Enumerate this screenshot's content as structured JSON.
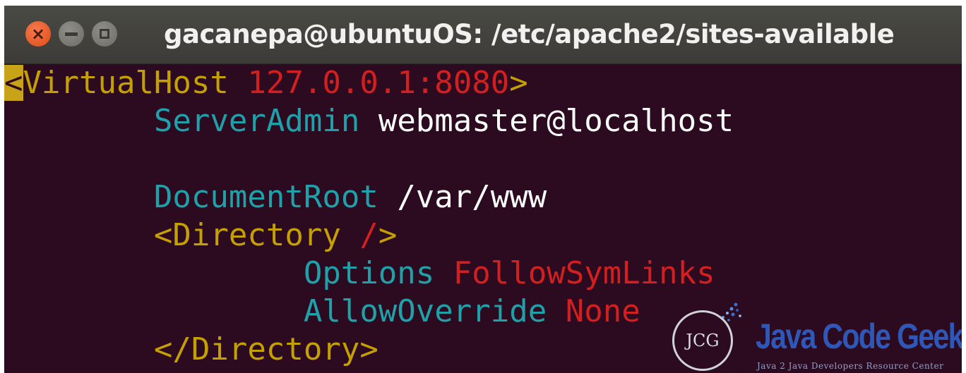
{
  "window": {
    "title": "gacanepa@ubuntuOS: /etc/apache2/sites-available",
    "buttons": {
      "close_glyph": "×",
      "close_icon": "close-icon",
      "minimize_icon": "minimize-icon",
      "maximize_icon": "maximize-icon"
    }
  },
  "colors": {
    "terminal_bg": "#2c0a1f",
    "titlebar_bg": "#3c3b37",
    "close_button": "#df4a16",
    "keyword_yellow": "#c4a000",
    "value_red": "#d21f1f",
    "directive_cyan": "#20a0a8",
    "text_white": "#ffffff",
    "cursor": "#c8a317"
  },
  "terminal": {
    "line1": {
      "cursor_char": "<",
      "tag": "VirtualHost",
      "space": " ",
      "arg": "127.0.0.1:8080",
      "close": ">"
    },
    "line2": {
      "indent": "        ",
      "directive": "ServerAdmin",
      "space": " ",
      "value": "webmaster@localhost"
    },
    "line3": {
      "text": ""
    },
    "line4": {
      "indent": "        ",
      "directive": "DocumentRoot",
      "space": " ",
      "value": "/var/www"
    },
    "line5": {
      "indent": "        ",
      "open": "<Directory",
      "space": " ",
      "arg": "/",
      "close": ">"
    },
    "line6": {
      "indent": "                ",
      "directive": "Options",
      "space": " ",
      "value": "FollowSymLinks"
    },
    "line7": {
      "indent": "                ",
      "directive": "AllowOverride",
      "space": " ",
      "value": "None"
    },
    "line8": {
      "indent": "        ",
      "tag": "</Directory>"
    }
  },
  "watermark": {
    "logo_text": "JCG",
    "name": "Java Code Geeks",
    "subtitle": "Java 2 Java Developers Resource Center"
  }
}
